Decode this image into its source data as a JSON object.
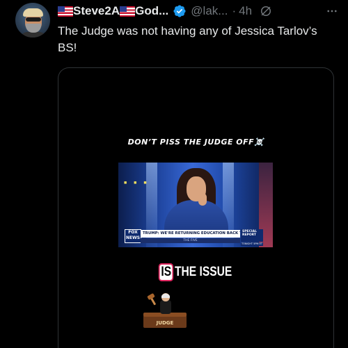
{
  "tweet": {
    "display_name": "Steve2A",
    "display_name_suffix": "God...",
    "handle": "@lak...",
    "separator": "·",
    "timestamp": "4h",
    "text": "The Judge was not having any of Jessica Tarlov’s BS!",
    "verified_color": "#1d9bf0"
  },
  "media": {
    "caption_top": "DON’T PISS THE JUDGE OFF☠️",
    "ticker_text": "TRUMP: WE'RE RETURNING EDUCATION BACK TO STATES",
    "network_logo": "FOX NEWS",
    "special_report": "SPECIAL REPORT",
    "show_name": "THE FIVE",
    "tonight_label": "TONIGHT 5PM ET",
    "issue_caption_box": "IS",
    "issue_caption_rest": "THE ISSUE",
    "judge_label": "JUDGE"
  },
  "icons": {
    "verified": "verified-badge-icon",
    "grok": "grok-icon",
    "more": "more-options-icon",
    "flag": "us-flag-icon"
  },
  "colors": {
    "background": "#000000",
    "text_primary": "#e7e9ea",
    "text_secondary": "#71767b",
    "border": "#2f3336"
  }
}
